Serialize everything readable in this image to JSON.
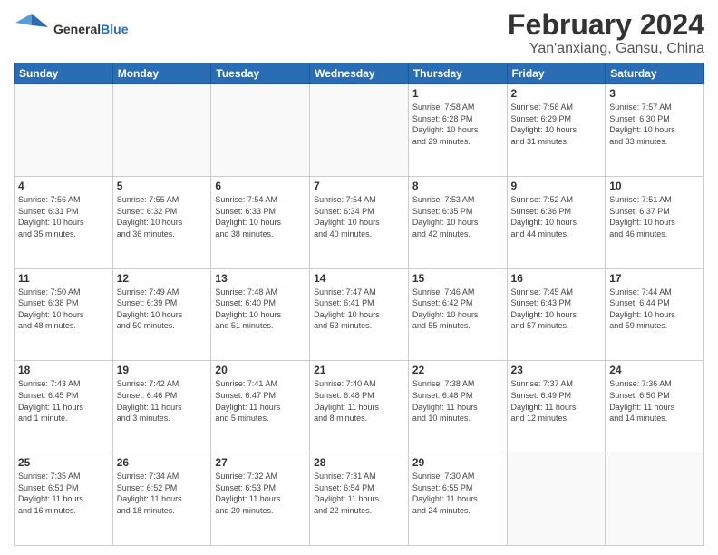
{
  "header": {
    "logo_general": "General",
    "logo_blue": "Blue",
    "month_title": "February 2024",
    "location": "Yan'anxiang, Gansu, China"
  },
  "weekdays": [
    "Sunday",
    "Monday",
    "Tuesday",
    "Wednesday",
    "Thursday",
    "Friday",
    "Saturday"
  ],
  "weeks": [
    [
      {
        "day": "",
        "info": ""
      },
      {
        "day": "",
        "info": ""
      },
      {
        "day": "",
        "info": ""
      },
      {
        "day": "",
        "info": ""
      },
      {
        "day": "1",
        "info": "Sunrise: 7:58 AM\nSunset: 6:28 PM\nDaylight: 10 hours\nand 29 minutes."
      },
      {
        "day": "2",
        "info": "Sunrise: 7:58 AM\nSunset: 6:29 PM\nDaylight: 10 hours\nand 31 minutes."
      },
      {
        "day": "3",
        "info": "Sunrise: 7:57 AM\nSunset: 6:30 PM\nDaylight: 10 hours\nand 33 minutes."
      }
    ],
    [
      {
        "day": "4",
        "info": "Sunrise: 7:56 AM\nSunset: 6:31 PM\nDaylight: 10 hours\nand 35 minutes."
      },
      {
        "day": "5",
        "info": "Sunrise: 7:55 AM\nSunset: 6:32 PM\nDaylight: 10 hours\nand 36 minutes."
      },
      {
        "day": "6",
        "info": "Sunrise: 7:54 AM\nSunset: 6:33 PM\nDaylight: 10 hours\nand 38 minutes."
      },
      {
        "day": "7",
        "info": "Sunrise: 7:54 AM\nSunset: 6:34 PM\nDaylight: 10 hours\nand 40 minutes."
      },
      {
        "day": "8",
        "info": "Sunrise: 7:53 AM\nSunset: 6:35 PM\nDaylight: 10 hours\nand 42 minutes."
      },
      {
        "day": "9",
        "info": "Sunrise: 7:52 AM\nSunset: 6:36 PM\nDaylight: 10 hours\nand 44 minutes."
      },
      {
        "day": "10",
        "info": "Sunrise: 7:51 AM\nSunset: 6:37 PM\nDaylight: 10 hours\nand 46 minutes."
      }
    ],
    [
      {
        "day": "11",
        "info": "Sunrise: 7:50 AM\nSunset: 6:38 PM\nDaylight: 10 hours\nand 48 minutes."
      },
      {
        "day": "12",
        "info": "Sunrise: 7:49 AM\nSunset: 6:39 PM\nDaylight: 10 hours\nand 50 minutes."
      },
      {
        "day": "13",
        "info": "Sunrise: 7:48 AM\nSunset: 6:40 PM\nDaylight: 10 hours\nand 51 minutes."
      },
      {
        "day": "14",
        "info": "Sunrise: 7:47 AM\nSunset: 6:41 PM\nDaylight: 10 hours\nand 53 minutes."
      },
      {
        "day": "15",
        "info": "Sunrise: 7:46 AM\nSunset: 6:42 PM\nDaylight: 10 hours\nand 55 minutes."
      },
      {
        "day": "16",
        "info": "Sunrise: 7:45 AM\nSunset: 6:43 PM\nDaylight: 10 hours\nand 57 minutes."
      },
      {
        "day": "17",
        "info": "Sunrise: 7:44 AM\nSunset: 6:44 PM\nDaylight: 10 hours\nand 59 minutes."
      }
    ],
    [
      {
        "day": "18",
        "info": "Sunrise: 7:43 AM\nSunset: 6:45 PM\nDaylight: 11 hours\nand 1 minute."
      },
      {
        "day": "19",
        "info": "Sunrise: 7:42 AM\nSunset: 6:46 PM\nDaylight: 11 hours\nand 3 minutes."
      },
      {
        "day": "20",
        "info": "Sunrise: 7:41 AM\nSunset: 6:47 PM\nDaylight: 11 hours\nand 5 minutes."
      },
      {
        "day": "21",
        "info": "Sunrise: 7:40 AM\nSunset: 6:48 PM\nDaylight: 11 hours\nand 8 minutes."
      },
      {
        "day": "22",
        "info": "Sunrise: 7:38 AM\nSunset: 6:48 PM\nDaylight: 11 hours\nand 10 minutes."
      },
      {
        "day": "23",
        "info": "Sunrise: 7:37 AM\nSunset: 6:49 PM\nDaylight: 11 hours\nand 12 minutes."
      },
      {
        "day": "24",
        "info": "Sunrise: 7:36 AM\nSunset: 6:50 PM\nDaylight: 11 hours\nand 14 minutes."
      }
    ],
    [
      {
        "day": "25",
        "info": "Sunrise: 7:35 AM\nSunset: 6:51 PM\nDaylight: 11 hours\nand 16 minutes."
      },
      {
        "day": "26",
        "info": "Sunrise: 7:34 AM\nSunset: 6:52 PM\nDaylight: 11 hours\nand 18 minutes."
      },
      {
        "day": "27",
        "info": "Sunrise: 7:32 AM\nSunset: 6:53 PM\nDaylight: 11 hours\nand 20 minutes."
      },
      {
        "day": "28",
        "info": "Sunrise: 7:31 AM\nSunset: 6:54 PM\nDaylight: 11 hours\nand 22 minutes."
      },
      {
        "day": "29",
        "info": "Sunrise: 7:30 AM\nSunset: 6:55 PM\nDaylight: 11 hours\nand 24 minutes."
      },
      {
        "day": "",
        "info": ""
      },
      {
        "day": "",
        "info": ""
      }
    ]
  ]
}
